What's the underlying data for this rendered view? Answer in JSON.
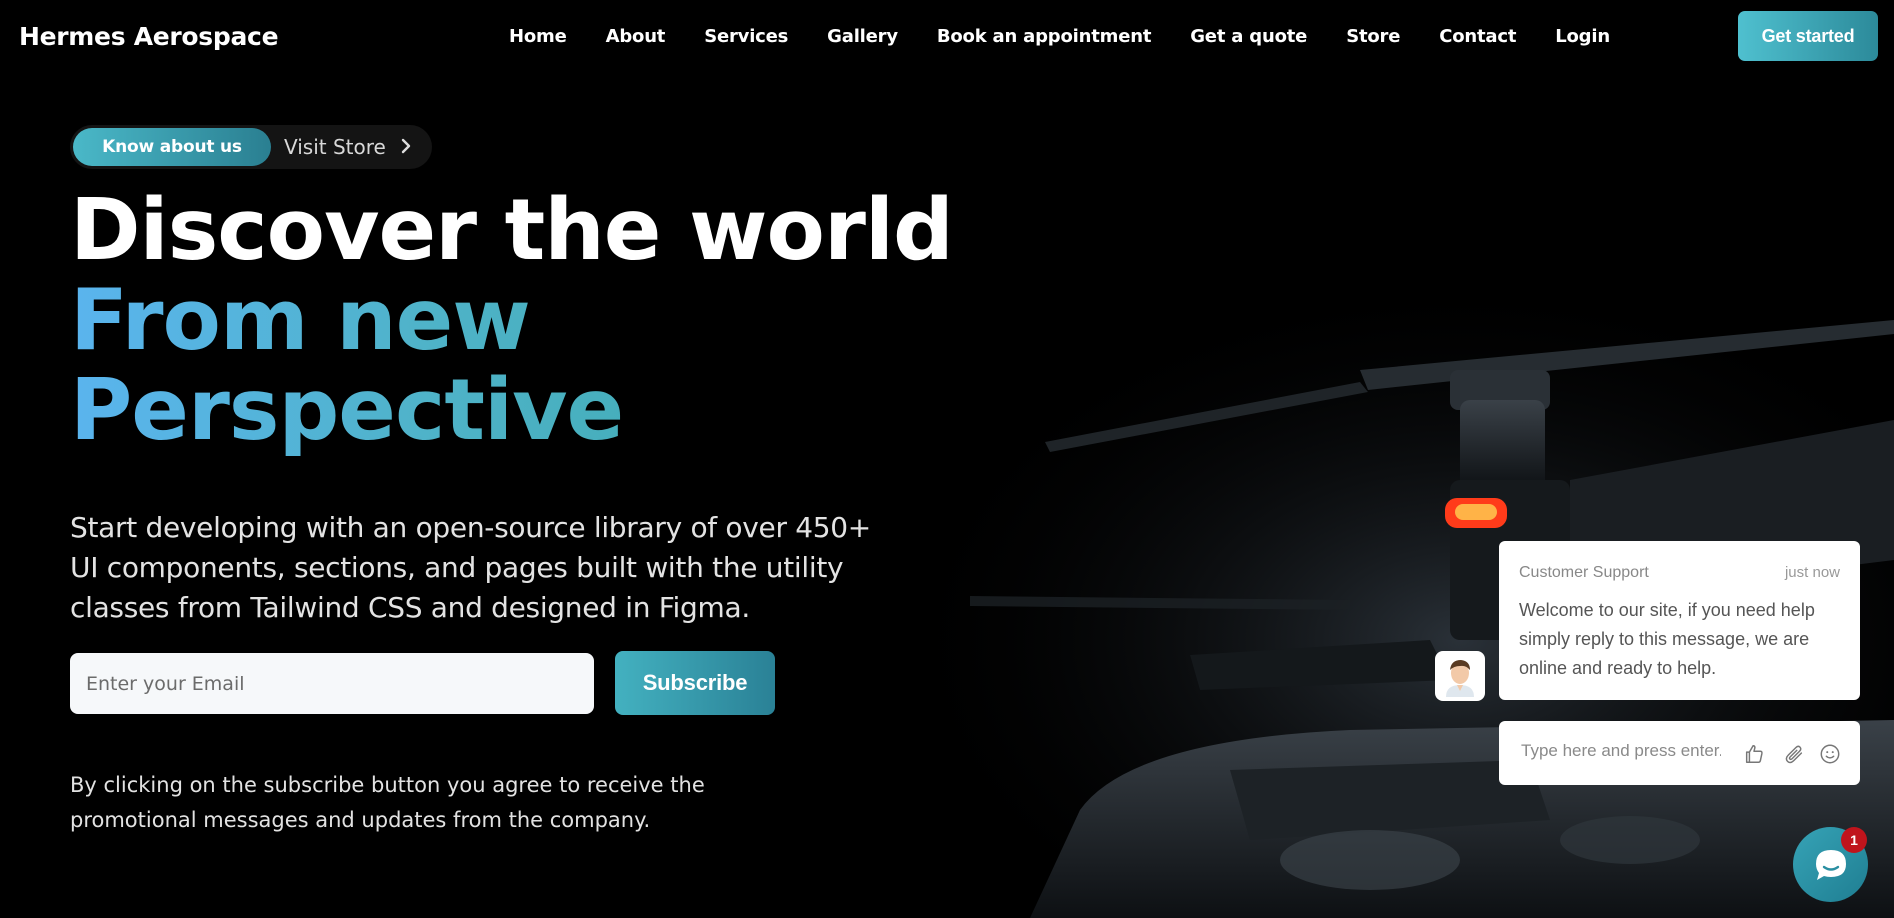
{
  "header": {
    "brand": "Hermes Aerospace",
    "nav": [
      "Home",
      "About",
      "Services",
      "Gallery",
      "Book an appointment",
      "Get a quote",
      "Store",
      "Contact",
      "Login"
    ],
    "cta_label": "Get started"
  },
  "hero": {
    "pill_primary": "Know about us",
    "pill_secondary": "Visit Store",
    "title_line1": "Discover the world",
    "title_line2": "From new",
    "title_line3": "Perspective",
    "lead": "Start developing with an open-source library of over 450+ UI components, sections, and pages built with the utility classes from Tailwind CSS and designed in Figma.",
    "email_placeholder": "Enter your Email",
    "subscribe_label": "Subscribe",
    "note": "By clicking on the subscribe button you agree to receive the promotional messages and updates from the company."
  },
  "chat": {
    "agent_name": "Customer Support",
    "timestamp": "just now",
    "message": "Welcome to our site, if you need help simply reply to this message, we are online and ready to help.",
    "input_placeholder": "Type here and press enter..",
    "unread_count": "1",
    "tools": [
      "thumbs-up-icon",
      "paperclip-icon",
      "smiley-icon"
    ]
  },
  "colors": {
    "accent_teal": "#3fb0c0",
    "title_blue": "#5ab4ee",
    "badge_red": "#c0141c"
  }
}
